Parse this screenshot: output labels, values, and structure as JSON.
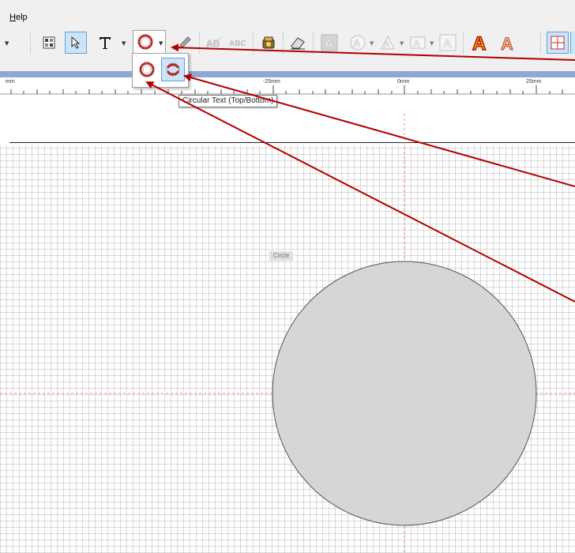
{
  "menu": {
    "help": "Help"
  },
  "toolbar": {
    "items": [
      "layout-icon",
      "select-arrow-icon",
      "text-tool-icon",
      "circular-text-icon",
      "pen-icon",
      "text-style-icon",
      "arc-text-icon",
      "paint-fill-icon",
      "eraser-icon",
      "outline-a-icon",
      "outline-a2-icon",
      "outline-a3-icon",
      "outline-a4-icon",
      "red-a-icon",
      "gradient-a-icon",
      "grid-snap-icon"
    ]
  },
  "popup": {
    "items": [
      "circular-text-outer-icon",
      "circular-text-topbottom-icon"
    ]
  },
  "tooltip": {
    "text": "Circular Text (Top/Bottom)"
  },
  "ruler": {
    "labels": [
      "mm",
      "-25mm",
      "0mm",
      "25mm"
    ]
  },
  "canvas": {
    "shape_label": "Circle"
  },
  "colors": {
    "accent_red": "#b00000",
    "ruler_band": "#8ea7d6",
    "circle_fill": "#d6d6d6",
    "guide": "#f28b8b"
  }
}
